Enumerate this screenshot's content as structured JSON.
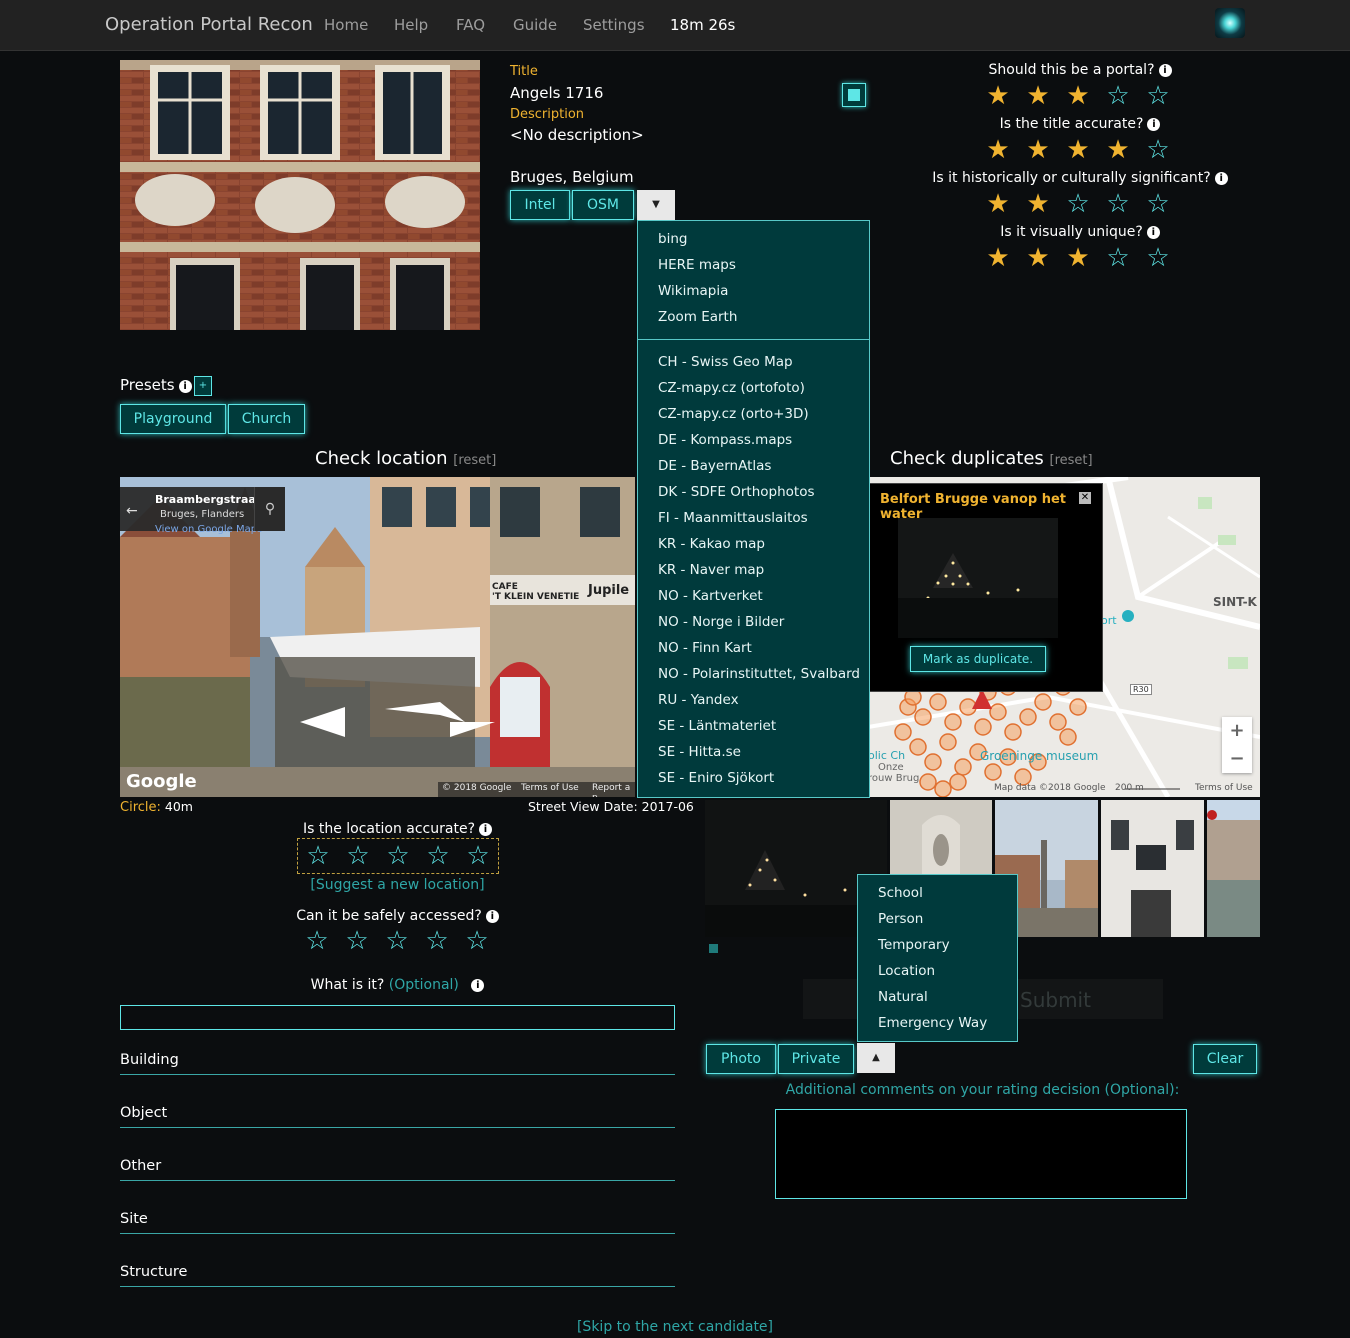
{
  "nav": {
    "brand": "Operation Portal Recon",
    "links": [
      "Home",
      "Help",
      "FAQ",
      "Guide",
      "Settings"
    ],
    "timer": "18m 26s"
  },
  "candidate": {
    "title_label": "Title",
    "title": "Angels 1716",
    "description_label": "Description",
    "description": "<No description>",
    "location": "Bruges, Belgium",
    "map_buttons": [
      "Intel",
      "OSM"
    ]
  },
  "map_dropdown": {
    "group1": [
      "bing",
      "HERE maps",
      "Wikimapia",
      "Zoom Earth"
    ],
    "group2": [
      "CH - Swiss Geo Map",
      "CZ-mapy.cz (ortofoto)",
      "CZ-mapy.cz (orto+3D)",
      "DE - Kompass.maps",
      "DE - BayernAtlas",
      "DK - SDFE Orthophotos",
      "FI - Maanmittauslaitos",
      "KR - Kakao map",
      "KR - Naver map",
      "NO - Kartverket",
      "NO - Norge i Bilder",
      "NO - Finn Kart",
      "NO - Polarinstituttet, Svalbard",
      "RU - Yandex",
      "SE - Läntmateriet",
      "SE - Hitta.se",
      "SE - Eniro Sjökort"
    ]
  },
  "ratings": {
    "portal": {
      "question": "Should this be a portal?",
      "value": 3
    },
    "title": {
      "question": "Is the title accurate?",
      "value": 4
    },
    "history": {
      "question": "Is it historically or culturally significant?",
      "value": 2
    },
    "unique": {
      "question": "Is it visually unique?",
      "value": 3
    },
    "location": {
      "question": "Is the location accurate?",
      "value": 0
    },
    "safety": {
      "question": "Can it be safely accessed?",
      "value": 0
    }
  },
  "presets": {
    "label": "Presets",
    "add_label": "+",
    "buttons": [
      "Playground",
      "Church"
    ]
  },
  "check_location": {
    "heading": "Check location",
    "reset": "[reset]",
    "street_name": "Braambergstraat",
    "street_sub": "Bruges, Flanders",
    "street_link": "View on Google Maps",
    "google_logo": "Google",
    "copyright": "© 2018 Google",
    "terms": "Terms of Use",
    "report": "Report a p",
    "cafe_sign": "CAFE\n'T KLEIN VENETIE",
    "jupiler": "Jupile",
    "circle_label": "Circle:",
    "circle_value": "40m",
    "street_view_date": "Street View Date: 2017-06",
    "suggest": "[Suggest a new location]"
  },
  "what_is_it": {
    "question": "What is it?",
    "optional": "(Optional)",
    "options": [
      "Building",
      "Object",
      "Other",
      "Site",
      "Structure"
    ]
  },
  "check_duplicates": {
    "heading": "Check duplicates",
    "reset": "[reset]",
    "popup_title": "Belfort Brugge vanop het water",
    "mark_button": "Mark as duplicate.",
    "map_labels": {
      "sint": "SINT-K",
      "r30": "R30",
      "museum": "Groeninge museum",
      "olic": "olic Ch",
      "onze": "Onze",
      "rouw": "rouw Brug",
      "ort": "ort"
    },
    "map_data": "Map data ©2018 Google",
    "scale": "200 m",
    "terms": "Terms of Use",
    "zoom_in": "+",
    "zoom_out": "−"
  },
  "reject_dropdown": {
    "items": [
      "School",
      "Person",
      "Temporary",
      "Location",
      "Natural",
      "Emergency Way"
    ]
  },
  "actions": {
    "submit": "Submit",
    "photo": "Photo",
    "private": "Private",
    "clear": "Clear",
    "comments_label": "Additional comments on your rating decision (Optional):",
    "skip": "[Skip to the next candidate]"
  },
  "colors": {
    "accent": "#5ee6e6",
    "star": "#f0b330",
    "dropdown_bg": "#003a3c"
  }
}
